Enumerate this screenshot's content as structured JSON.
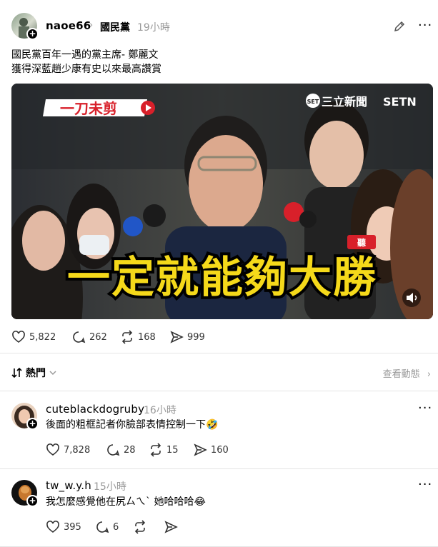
{
  "post": {
    "username": "naoe66",
    "topic": "國民黨",
    "time": "19小時",
    "text_line1": "國民黨百年一遇的黨主席- 鄭麗文",
    "text_line2": "獲得深藍趙少康有史以來最高讚賞",
    "video": {
      "logo_left": "一刀未剪",
      "logo_right_sub": "SET",
      "logo_right_main": "三立新聞",
      "logo_right_brand": "SETN",
      "caption": "一定就能夠大勝",
      "mic_label": "聽"
    },
    "likes": "5,822",
    "comments": "262",
    "reposts": "168",
    "shares": "999"
  },
  "sort": {
    "label": "熱門",
    "activity": "查看動態"
  },
  "replies": [
    {
      "username": "cuteblackdogruby",
      "time": "16小時",
      "text": "後面的粗框記者你臉部表情控制一下🤣",
      "likes": "7,828",
      "comments": "28",
      "reposts": "15",
      "shares": "160"
    },
    {
      "username": "tw_w.y.h",
      "time": "15小時",
      "text": "我怎麼感覺他在尻ㄙㄟˋ 她哈哈哈😂",
      "likes": "395",
      "comments": "6",
      "reposts": "",
      "shares": ""
    }
  ],
  "colors": {
    "caption_fill": "#f5d91a",
    "caption_stroke": "#000000",
    "logo_red": "#d8202a"
  },
  "icons": [
    "edit-icon",
    "more-icon",
    "heart-icon",
    "comment-icon",
    "repost-icon",
    "share-icon",
    "sort-icon",
    "chevron-down-icon",
    "chevron-right-icon",
    "speaker-icon"
  ]
}
